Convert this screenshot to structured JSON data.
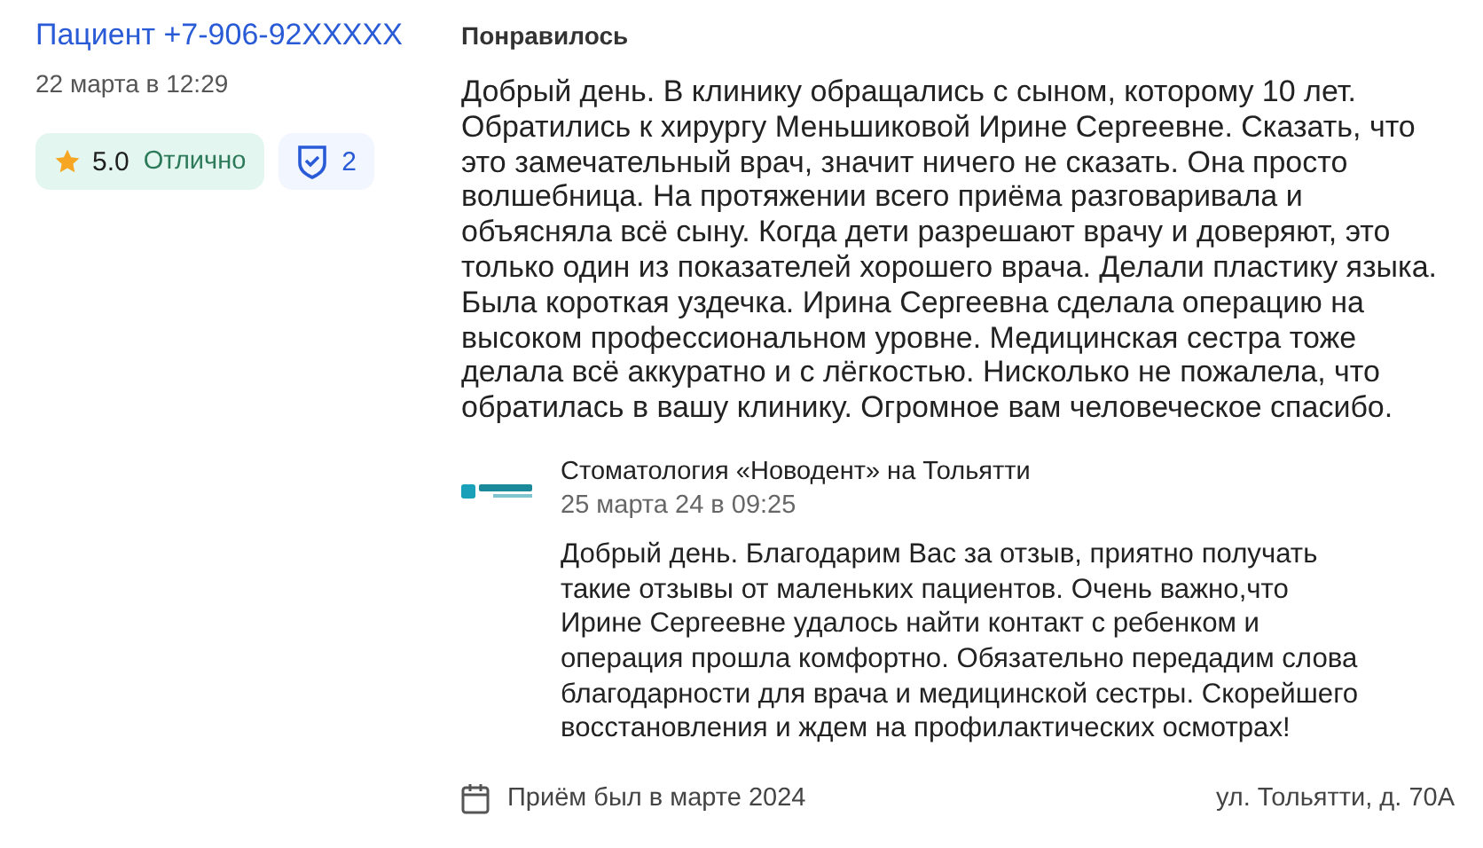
{
  "author": {
    "name": "Пациент +7-906-92XXXXX",
    "date": "22 марта в 12:29"
  },
  "rating": {
    "score": "5.0",
    "label": "Отлично"
  },
  "verification": {
    "count": "2"
  },
  "review": {
    "heading": "Понравилось",
    "text": "Добрый день. В клинику обращались с сыном, которому 10 лет. Обратились к хирургу Меньшиковой Ирине Сергеевне. Сказать, что это замечательный врач, значит ничего не сказать. Она просто волшебница. На протяжении всего приёма разговаривала и объясняла всё сыну. Когда дети разрешают врачу и доверяют, это только один из показателей хорошего врача. Делали пластику языка. Была короткая уздечка. Ирина Сергеевна сделала операцию на высоком профессиональном уровне. Медицинская сестра тоже делала всё аккуратно и с лёгкостью. Нисколько не пожалела, что обратилась в вашу клинику. Огромное вам человеческое спасибо."
  },
  "reply": {
    "clinic": "Стоматология «Новодент» на Тольятти",
    "date": "25 марта 24 в 09:25",
    "text": "Добрый день. Благодарим Вас за отзыв, приятно получать такие отзывы от маленьких пациентов. Очень важно,что Ирине Сергеевне удалось найти контакт с ребенком и операция прошла комфортно. Обязательно передадим слова благодарности для врача и медицинской сестры. Скорейшего восстановления и ждем на профилактических осмотрах!"
  },
  "footer": {
    "visit": "Приём был в марте 2024",
    "address": "ул. Тольятти, д. 70А"
  }
}
